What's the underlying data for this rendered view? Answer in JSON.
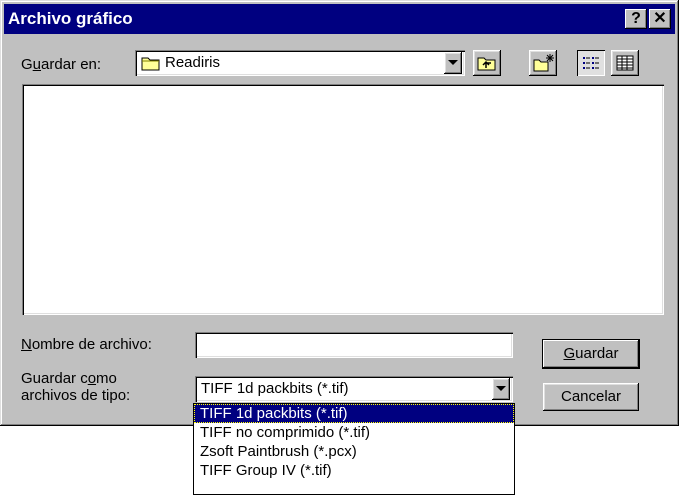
{
  "window": {
    "title": "Archivo gráfico",
    "help_label": "?",
    "close_label": "✕"
  },
  "save_in": {
    "label_pre": "G",
    "label_ul": "u",
    "label_post": "ardar en:",
    "value": "Readiris"
  },
  "toolbar": {
    "icons": [
      "up-one-level-icon",
      "new-folder-icon",
      "list-view-icon",
      "details-view-icon"
    ]
  },
  "filename": {
    "label_ul": "N",
    "label_post": "ombre de archivo:",
    "value": ""
  },
  "filetype": {
    "label_line1_pre": "Guardar c",
    "label_line1_ul": "o",
    "label_line1_post": "mo",
    "label_line2": "archivos de tipo:",
    "value": "TIFF 1d packbits (*.tif)",
    "options": [
      "TIFF 1d packbits (*.tif)",
      "TIFF no comprimido (*.tif)",
      "Zsoft Paintbrush (*.pcx)",
      "TIFF Group IV (*.tif)"
    ],
    "selected_index": 0
  },
  "buttons": {
    "save_ul": "G",
    "save_post": "uardar",
    "cancel": "Cancelar"
  },
  "colors": {
    "titlebar": "#000080",
    "face": "#c0c0c0",
    "selection": "#000080"
  }
}
